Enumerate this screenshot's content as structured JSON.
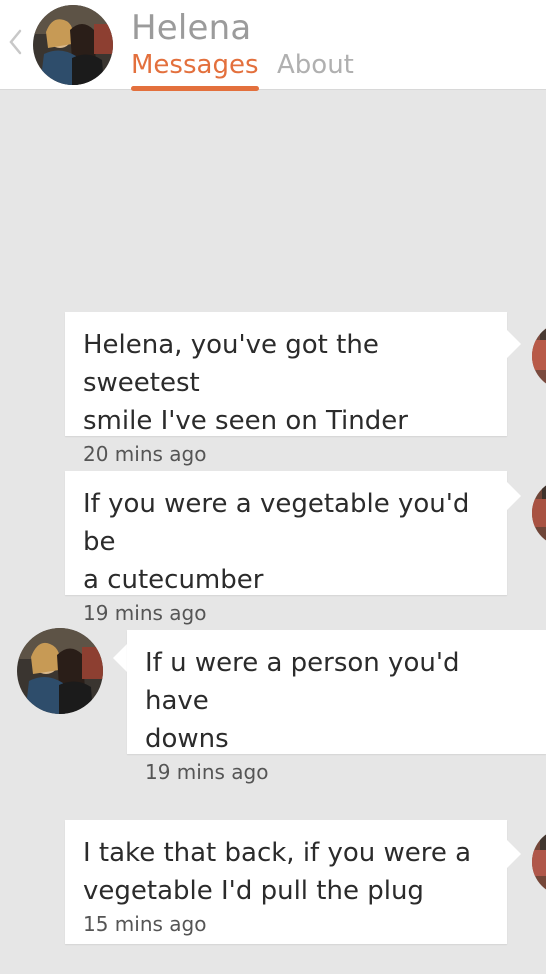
{
  "header": {
    "contact_name": "Helena",
    "tabs": [
      {
        "label": "Messages",
        "active": true
      },
      {
        "label": "About",
        "active": false
      }
    ],
    "back_icon": "chevron-left-icon"
  },
  "colors": {
    "accent": "#e3703d",
    "background": "#e6e6e6",
    "bubble": "#ffffff"
  },
  "messages": [
    {
      "sender": "me",
      "lines": [
        "Helena, you've got the sweetest",
        "smile I've seen on Tinder"
      ],
      "time": "20 mins ago"
    },
    {
      "sender": "me",
      "lines": [
        "If you were a vegetable you'd be",
        "a cutecumber"
      ],
      "time": "19 mins ago"
    },
    {
      "sender": "match",
      "lines": [
        "If u were a person you'd have",
        "downs"
      ],
      "time": "19 mins ago"
    },
    {
      "sender": "me",
      "lines": [
        "I take that back, if you were a",
        "vegetable I'd pull the plug"
      ],
      "time": "15 mins ago"
    }
  ]
}
